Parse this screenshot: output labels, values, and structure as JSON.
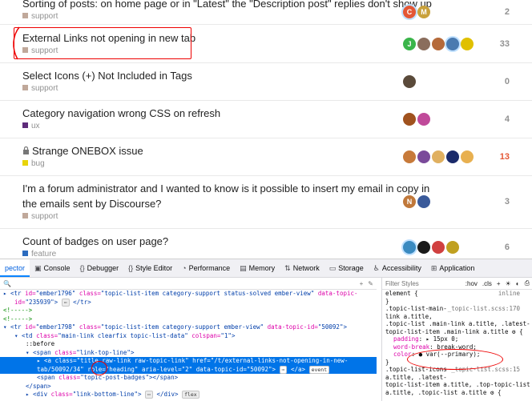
{
  "topics": [
    {
      "title": "Sorting of posts: on home page or in \"Latest\" the \"Description post\" replies don't show up",
      "category": "support",
      "cat_color": "#c0a89a",
      "count": "2",
      "posters": [
        {
          "bg": "#e45735",
          "letter": "C",
          "hl": true
        },
        {
          "bg": "#c9a13b",
          "letter": "M",
          "hl": false
        }
      ]
    },
    {
      "title": "External Links not opening in new tab",
      "category": "support",
      "cat_color": "#c0a89a",
      "count": "33",
      "posters": [
        {
          "bg": "#3ab54a",
          "letter": "J",
          "hl": false
        },
        {
          "bg": "#8a6d5c",
          "letter": "",
          "hl": false
        },
        {
          "bg": "#b56a3a",
          "letter": "",
          "hl": false
        },
        {
          "bg": "#4a7ab0",
          "letter": "",
          "hl": true
        },
        {
          "bg": "#e0c000",
          "letter": "",
          "hl": false
        }
      ]
    },
    {
      "title": "Select Icons (+) Not Included in Tags",
      "category": "support",
      "cat_color": "#c0a89a",
      "count": "0",
      "posters": [
        {
          "bg": "#5a4a3a",
          "letter": "",
          "hl": false
        }
      ]
    },
    {
      "title": "Category navigation wrong CSS on refresh",
      "category": "ux",
      "cat_color": "#5e2b7a",
      "count": "4",
      "posters": [
        {
          "bg": "#a0521e",
          "letter": "",
          "hl": false
        },
        {
          "bg": "#c04a9a",
          "letter": "",
          "hl": false
        }
      ]
    },
    {
      "title": "Strange ONEBOX issue",
      "category": "bug",
      "cat_color": "#e8d40a",
      "count": "13",
      "hot": true,
      "posters": [
        {
          "bg": "#c77a3a",
          "letter": "",
          "hl": false
        },
        {
          "bg": "#7a4a9a",
          "letter": "",
          "hl": false
        },
        {
          "bg": "#e0b060",
          "letter": "",
          "hl": false
        },
        {
          "bg": "#1a2a6a",
          "letter": "",
          "hl": false
        },
        {
          "bg": "#e8b050",
          "letter": "",
          "hl": false
        }
      ]
    },
    {
      "title": "I'm a forum administrator and I wanted to know is it possible to insert my email in copy in",
      "title2": "the emails sent by Discourse?",
      "category": "support",
      "cat_color": "#c0a89a",
      "count": "3",
      "posters": [
        {
          "bg": "#c0783a",
          "letter": "N",
          "hl": false
        },
        {
          "bg": "#3a5a9a",
          "letter": "",
          "hl": false
        }
      ]
    },
    {
      "title": "Count of badges on user page?",
      "category": "feature",
      "cat_color": "#2b6cbf",
      "count": "6",
      "posters": [
        {
          "bg": "#3a8ac0",
          "letter": "",
          "hl": true
        },
        {
          "bg": "#1a1a1a",
          "letter": "",
          "hl": false
        },
        {
          "bg": "#d04040",
          "letter": "",
          "hl": false
        },
        {
          "bg": "#c0a020",
          "letter": "",
          "hl": false
        }
      ]
    }
  ],
  "devtools": {
    "tabs": [
      {
        "label": "pector",
        "icon": ""
      },
      {
        "label": "Console",
        "icon": "▣"
      },
      {
        "label": "Debugger",
        "icon": "{}"
      },
      {
        "label": "Style Editor",
        "icon": "{}"
      },
      {
        "label": "Performance",
        "icon": "◔"
      },
      {
        "label": "Memory",
        "icon": "▤"
      },
      {
        "label": "Network",
        "icon": "⇅"
      },
      {
        "label": "Storage",
        "icon": "▭"
      },
      {
        "label": "Accessibility",
        "icon": "♿"
      },
      {
        "label": "Application",
        "icon": "⊞"
      }
    ],
    "html_lines": [
      {
        "indent": 0,
        "parts": [
          [
            "tg",
            "▸ <tr "
          ],
          [
            "at",
            "id="
          ],
          [
            "av2",
            "\"ember1796\" "
          ],
          [
            "at",
            "class="
          ],
          [
            "av2",
            "\"topic-list-item category-support status-solved ember-view\" "
          ],
          [
            "at",
            "data-topic-"
          ]
        ]
      },
      {
        "indent": 1,
        "parts": [
          [
            "at",
            "id="
          ],
          [
            "av2",
            "\"235939\""
          ],
          [
            "tg",
            "> "
          ],
          [
            "badge",
            "⋯"
          ],
          [
            "tg",
            " </tr>"
          ]
        ]
      },
      {
        "indent": 0,
        "parts": [
          [
            "cm",
            "<!----->"
          ]
        ]
      },
      {
        "indent": 0,
        "parts": [
          [
            "cm",
            "<!----->"
          ]
        ]
      },
      {
        "indent": 0,
        "parts": [
          [
            "tg",
            "▾ <tr "
          ],
          [
            "at",
            "id="
          ],
          [
            "av2",
            "\"ember1798\" "
          ],
          [
            "at",
            "class="
          ],
          [
            "av2",
            "\"topic-list-item category-support ember-view\" "
          ],
          [
            "at",
            "data-topic-id="
          ],
          [
            "av2",
            "\"50092\""
          ],
          [
            "tg",
            ">"
          ]
        ]
      },
      {
        "indent": 1,
        "parts": [
          [
            "tg",
            "▾ <td "
          ],
          [
            "at",
            "class="
          ],
          [
            "av2",
            "\"main-link clearfix topic-list-data\" "
          ],
          [
            "at",
            "colspan="
          ],
          [
            "av2",
            "\"1\""
          ],
          [
            "tg",
            ">"
          ]
        ]
      },
      {
        "indent": 2,
        "parts": [
          [
            "tx",
            "::before"
          ]
        ]
      },
      {
        "indent": 2,
        "parts": [
          [
            "tg",
            "▾ <span "
          ],
          [
            "at",
            "class="
          ],
          [
            "av2",
            "\"link-top-line\""
          ],
          [
            "tg",
            ">"
          ]
        ]
      },
      {
        "indent": 3,
        "sel": true,
        "parts": [
          [
            "tg",
            "▸ <a "
          ],
          [
            "at",
            "class="
          ],
          [
            "av2",
            "\"title raw-link raw-topic-link\" "
          ],
          [
            "at",
            "href="
          ],
          [
            "av2",
            "\"/t/external-links-not-opening-in-new-"
          ]
        ]
      },
      {
        "indent": 3,
        "sel": true,
        "parts": [
          [
            "av2",
            "tab/50092/34\" "
          ],
          [
            "at",
            "role="
          ],
          [
            "av2",
            "\"heading\" "
          ],
          [
            "at",
            "aria-level="
          ],
          [
            "av2",
            "\"2\" "
          ],
          [
            "at",
            "data-topic-id="
          ],
          [
            "av2",
            "\"50092\""
          ],
          [
            "tg",
            "> "
          ],
          [
            "badge",
            "⋯"
          ],
          [
            "tg",
            " </a> "
          ],
          [
            "badge",
            "event"
          ]
        ]
      },
      {
        "indent": 3,
        "parts": [
          [
            "tg",
            "<span "
          ],
          [
            "at",
            "class="
          ],
          [
            "av2",
            "\"topic-post-badges\""
          ],
          [
            "tg",
            "></span>"
          ]
        ]
      },
      {
        "indent": 2,
        "parts": [
          [
            "tg",
            "</span>"
          ]
        ]
      },
      {
        "indent": 2,
        "parts": [
          [
            "tg",
            "▸ <div "
          ],
          [
            "at",
            "class="
          ],
          [
            "av2",
            "\"link-bottom-line\""
          ],
          [
            "tg",
            "> "
          ],
          [
            "badge",
            "⋯"
          ],
          [
            "tg",
            " </div> "
          ],
          [
            "badge",
            "flex"
          ]
        ]
      }
    ],
    "rules_toolbar": {
      "filter": "Filter Styles",
      "hov": ":hov",
      ".cls": ".cls",
      "plus": "+"
    },
    "rules": [
      {
        "kind": "sel",
        "text": "element {",
        "src": "inline"
      },
      {
        "kind": "close",
        "text": "}"
      },
      {
        "kind": "sel",
        "text": ".topic-list-main-",
        "src": "_topic-list.scss:170"
      },
      {
        "kind": "sel",
        "text": "link a.title,"
      },
      {
        "kind": "sel",
        "text": ".topic-list .main-link a.title, .latest-"
      },
      {
        "kind": "sel",
        "text": "topic-list-item .main-link a.title ⚙ {"
      },
      {
        "kind": "prop",
        "name": "padding",
        "value": "▸ 15px 0;"
      },
      {
        "kind": "prop",
        "name": "word-break",
        "value": "break-word;"
      },
      {
        "kind": "prop",
        "name": "color",
        "value": "● var(--primary);"
      },
      {
        "kind": "close",
        "text": "}"
      },
      {
        "kind": "sel",
        "text": ".topic-list-icons",
        "src": "_topic-list.scss:15"
      },
      {
        "kind": "sel",
        "text": "a.title, .latest-"
      },
      {
        "kind": "sel",
        "text": "topic-list-item a.title, .top-topic-list"
      },
      {
        "kind": "sel",
        "text": "a.title, .topic-list a.title ⚙ {"
      }
    ]
  }
}
